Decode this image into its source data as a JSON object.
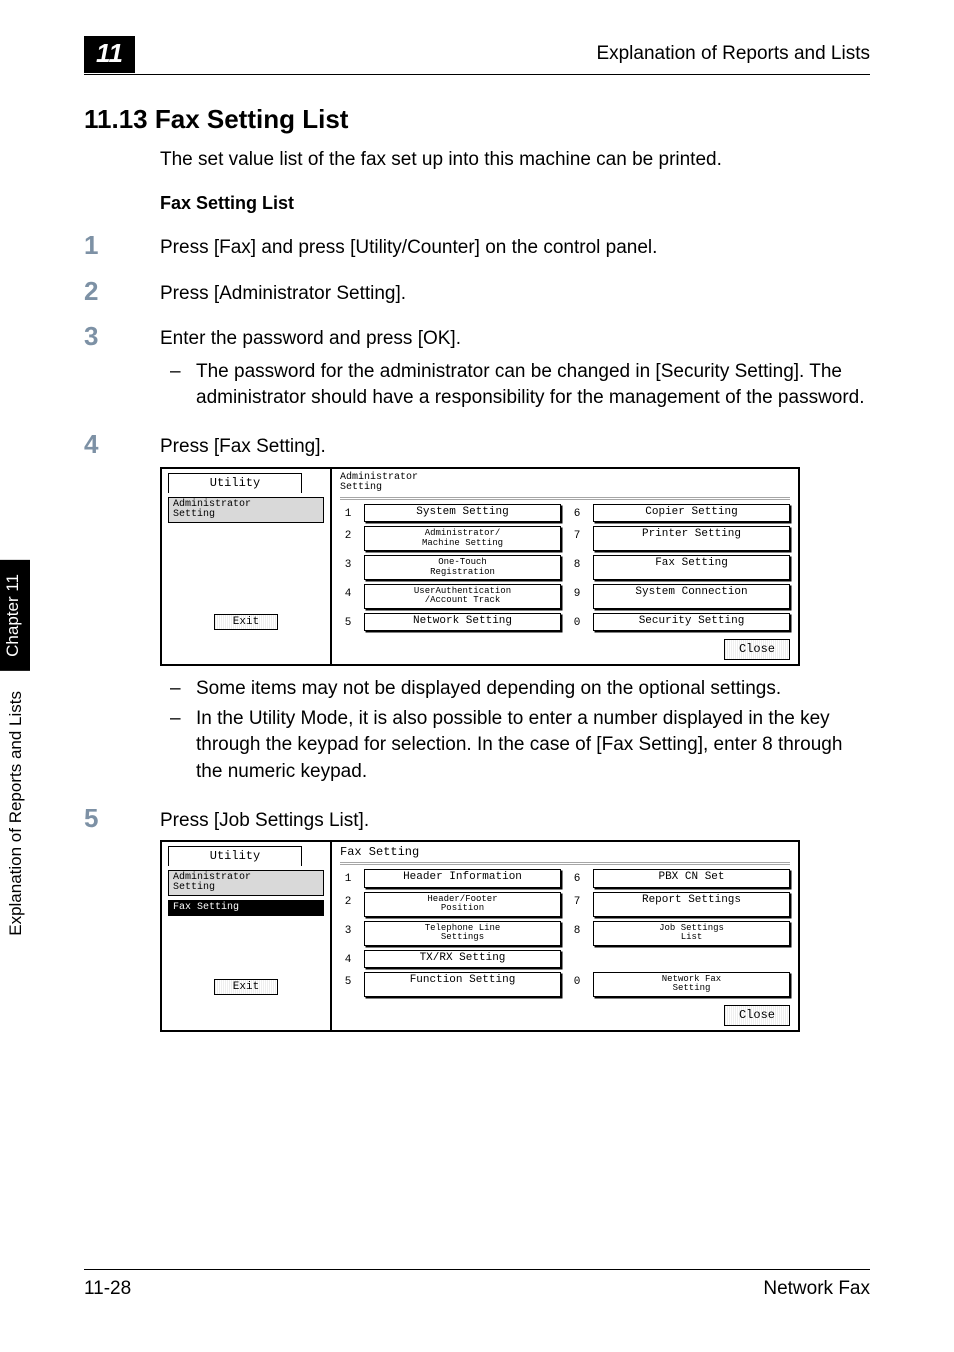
{
  "header": {
    "chapter_number": "11",
    "running_head": "Explanation of Reports and Lists"
  },
  "section": {
    "title": "11.13 Fax Setting List",
    "intro": "The set value list of the fax set up into this machine can be printed.",
    "subhead": "Fax Setting List"
  },
  "steps": {
    "s1": {
      "num": "1",
      "text": "Press [Fax] and press [Utility/Counter] on the control panel."
    },
    "s2": {
      "num": "2",
      "text": "Press [Administrator Setting]."
    },
    "s3": {
      "num": "3",
      "text": "Enter the password and press [OK].",
      "note1": "The password for the administrator can be changed in [Security Setting]. The administrator should have a responsibility for the management of the password."
    },
    "s4": {
      "num": "4",
      "text": "Press [Fax Setting].",
      "note1": "Some items may not be displayed depending on the optional settings.",
      "note2": "In the Utility Mode, it is also possible to enter a number displayed in the key through the keypad for selection. In the case of [Fax Setting], enter 8 through the numeric keypad."
    },
    "s5": {
      "num": "5",
      "text": "Press [Job Settings List]."
    }
  },
  "lcd1": {
    "side_tab_top": "Utility",
    "side_tab_sub": "Administrator\nSetting",
    "title": "Administrator\nSetting",
    "items_left_nums": [
      "1",
      "2",
      "3",
      "4",
      "5"
    ],
    "items_left_labels": [
      "System Setting",
      "Administrator/\nMachine Setting",
      "One-Touch\nRegistration",
      "UserAuthentication\n/Account Track",
      "Network Setting"
    ],
    "items_right_nums": [
      "6",
      "7",
      "8",
      "9",
      "0"
    ],
    "items_right_labels": [
      "Copier Setting",
      "Printer Setting",
      "Fax Setting",
      "System Connection",
      "Security Setting"
    ],
    "exit_label": "Exit",
    "close_label": "Close"
  },
  "lcd2": {
    "side_tab_top": "Utility",
    "side_tab_sub1": "Administrator\nSetting",
    "side_tab_sub2": "Fax Setting",
    "title": "Fax Setting",
    "items_left_nums": [
      "1",
      "2",
      "3",
      "4",
      "5"
    ],
    "items_left_labels": [
      "Header Information",
      "Header/Footer\nPosition",
      "Telephone Line\nSettings",
      "TX/RX Setting",
      "Function Setting"
    ],
    "items_right_nums": [
      "6",
      "7",
      "8",
      "",
      "0"
    ],
    "items_right_labels": [
      "PBX CN Set",
      "Report Settings",
      "Job Settings\nList",
      "",
      "Network Fax\nSetting"
    ],
    "exit_label": "Exit",
    "close_label": "Close"
  },
  "side_label": {
    "black": "Chapter 11",
    "plain": "Explanation of Reports and Lists"
  },
  "footer": {
    "left": "11-28",
    "right": "Network Fax"
  }
}
